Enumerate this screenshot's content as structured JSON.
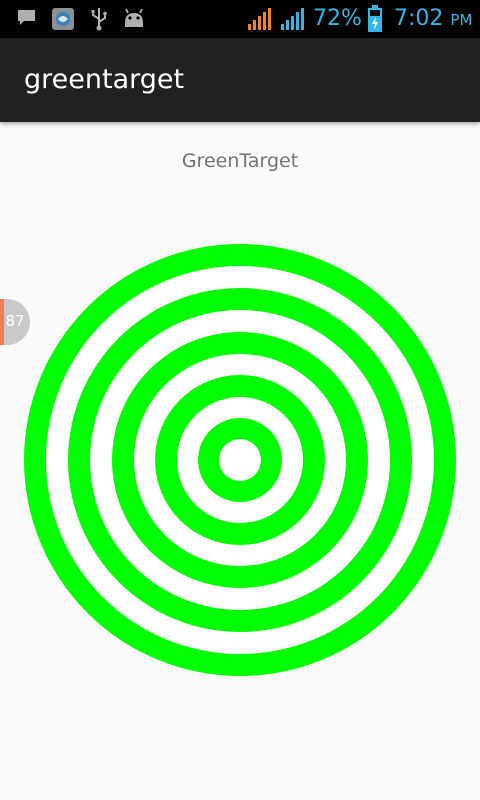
{
  "status_bar": {
    "battery": "72%",
    "time": "7:02",
    "ampm": "PM",
    "icons": [
      "message-icon",
      "app-icon",
      "usb-icon",
      "android-icon",
      "signal-icon",
      "signal-icon",
      "battery-charging-icon"
    ],
    "accent_color": "#33b5e5",
    "signal_color_1": "#f58220"
  },
  "app_bar": {
    "title": "greentarget"
  },
  "main": {
    "label": "GreenTarget",
    "target_color": "#00ff00",
    "ring_count": 5
  },
  "floating_badge": {
    "count": "87"
  }
}
